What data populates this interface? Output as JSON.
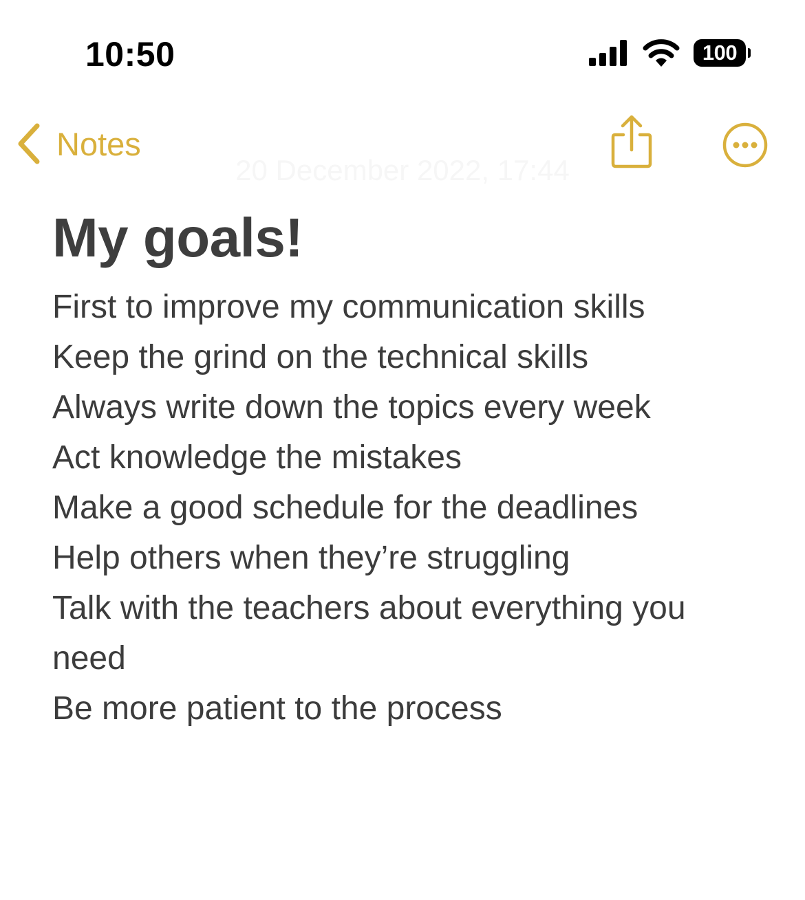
{
  "status_bar": {
    "time": "10:50",
    "battery": "100"
  },
  "nav": {
    "back_label": "Notes",
    "accent_color": "#d9b03c",
    "icons": [
      "chevron-left-icon",
      "share-icon",
      "more-icon"
    ]
  },
  "note": {
    "date": "20 December 2022, 17:44",
    "title": "My goals!",
    "lines": [
      "First to improve my communication skills",
      "Keep the grind on the technical skills",
      "Always write down the topics every week",
      "Act knowledge the mistakes",
      "Make a good schedule for the deadlines",
      "Help others when they’re struggling",
      "Talk with the teachers about everything you",
      "need",
      "Be more patient to the process"
    ]
  }
}
